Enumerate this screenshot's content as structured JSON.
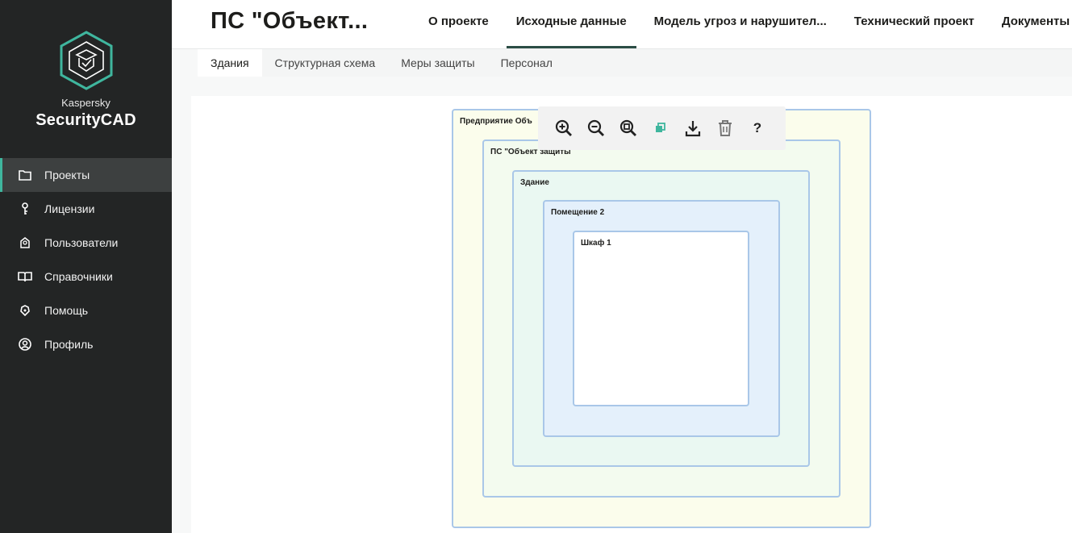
{
  "sidebar": {
    "brand_small": "Kaspersky",
    "brand_big": "SecurityCAD",
    "items": [
      {
        "label": "Проекты",
        "icon": "folder-icon"
      },
      {
        "label": "Лицензии",
        "icon": "key-icon"
      },
      {
        "label": "Пользователи",
        "icon": "users-icon"
      },
      {
        "label": "Справочники",
        "icon": "book-icon"
      },
      {
        "label": "Помощь",
        "icon": "help-icon"
      },
      {
        "label": "Профиль",
        "icon": "profile-icon"
      }
    ]
  },
  "header": {
    "project_title": "ПС \"Объект...",
    "tabs": [
      "О проекте",
      "Исходные данные",
      "Модель угроз и нарушител...",
      "Технический проект",
      "Документы"
    ]
  },
  "subtabs": [
    "Здания",
    "Структурная схема",
    "Меры защиты",
    "Персонал"
  ],
  "diagram": {
    "labels": [
      "Предприятие Объ",
      "ПС \"Объект защиты",
      "Здание",
      "Помещение 2",
      "Шкаф 1"
    ]
  },
  "toolbar": {
    "icons": [
      "zoom-in-icon",
      "zoom-out-icon",
      "zoom-fit-icon",
      "copy-icon",
      "download-icon",
      "trash-icon",
      "help-question-icon"
    ],
    "help_label": "?"
  },
  "colors": {
    "sidebar_bg": "#232525",
    "accent": "#3fb69e",
    "tab_underline": "#2b4d45",
    "box_border": "#a9c7e8"
  }
}
